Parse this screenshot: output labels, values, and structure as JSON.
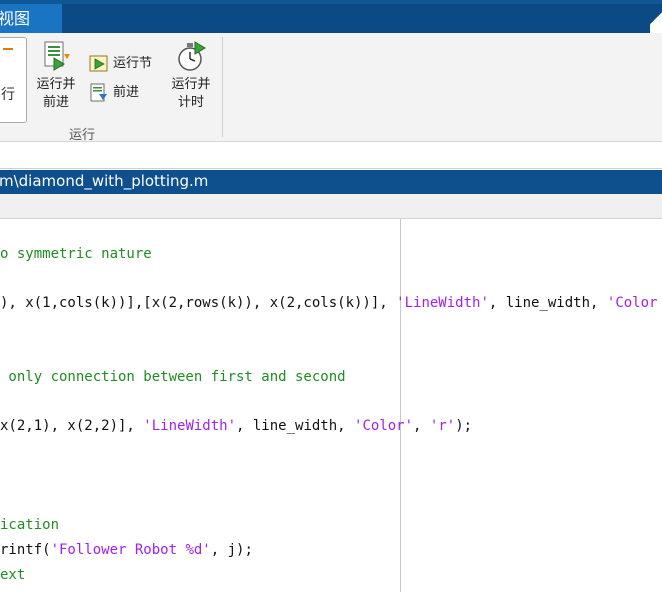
{
  "tabs": {
    "active_label": "视图"
  },
  "ribbon": {
    "prev_button_label": "行",
    "run_and_advance_line1": "运行并",
    "run_and_advance_line2": "前进",
    "run_section_label": "运行节",
    "advance_label": "前进",
    "run_and_time_line1": "运行并",
    "run_and_time_line2": "计时",
    "group_label": "运行"
  },
  "editor": {
    "file_path": "m\\diamond_with_plotting.m",
    "lines": [
      {
        "id": "l1",
        "parts": [
          {
            "t": "o symmetric nature",
            "c": "cmt"
          }
        ]
      },
      {
        "id": "l2",
        "parts": [
          {
            "t": "), x(1,cols(k))],[x(2,rows(k)), x(2,cols(k))], ",
            "c": ""
          },
          {
            "t": "'LineWidth'",
            "c": "str"
          },
          {
            "t": ", line_width, ",
            "c": ""
          },
          {
            "t": "'Color",
            "c": "str"
          }
        ]
      },
      {
        "id": "l3",
        "parts": [
          {
            "t": " only connection between first and second",
            "c": "cmt"
          }
        ]
      },
      {
        "id": "l4",
        "parts": [
          {
            "t": "x(2,1), x(2,2)], ",
            "c": ""
          },
          {
            "t": "'LineWidth'",
            "c": "str"
          },
          {
            "t": ", line_width, ",
            "c": ""
          },
          {
            "t": "'Color'",
            "c": "str"
          },
          {
            "t": ", ",
            "c": ""
          },
          {
            "t": "'r'",
            "c": "str"
          },
          {
            "t": ");",
            "c": ""
          }
        ]
      },
      {
        "id": "l5",
        "parts": [
          {
            "t": "ication",
            "c": "cmt"
          }
        ]
      },
      {
        "id": "l6",
        "parts": [
          {
            "t": "rintf(",
            "c": ""
          },
          {
            "t": "'Follower Robot %d'",
            "c": "str"
          },
          {
            "t": ", j);",
            "c": ""
          }
        ]
      },
      {
        "id": "l7",
        "parts": [
          {
            "t": "ext",
            "c": "cmt"
          }
        ]
      }
    ]
  },
  "colors": {
    "tab_strip": "#0f5797",
    "comment": "#228b22",
    "string": "#a020f0"
  },
  "icons": {
    "run_and_advance": "run-advance-icon",
    "run_section": "run-section-icon",
    "advance": "advance-icon",
    "run_and_time": "stopwatch-icon"
  }
}
